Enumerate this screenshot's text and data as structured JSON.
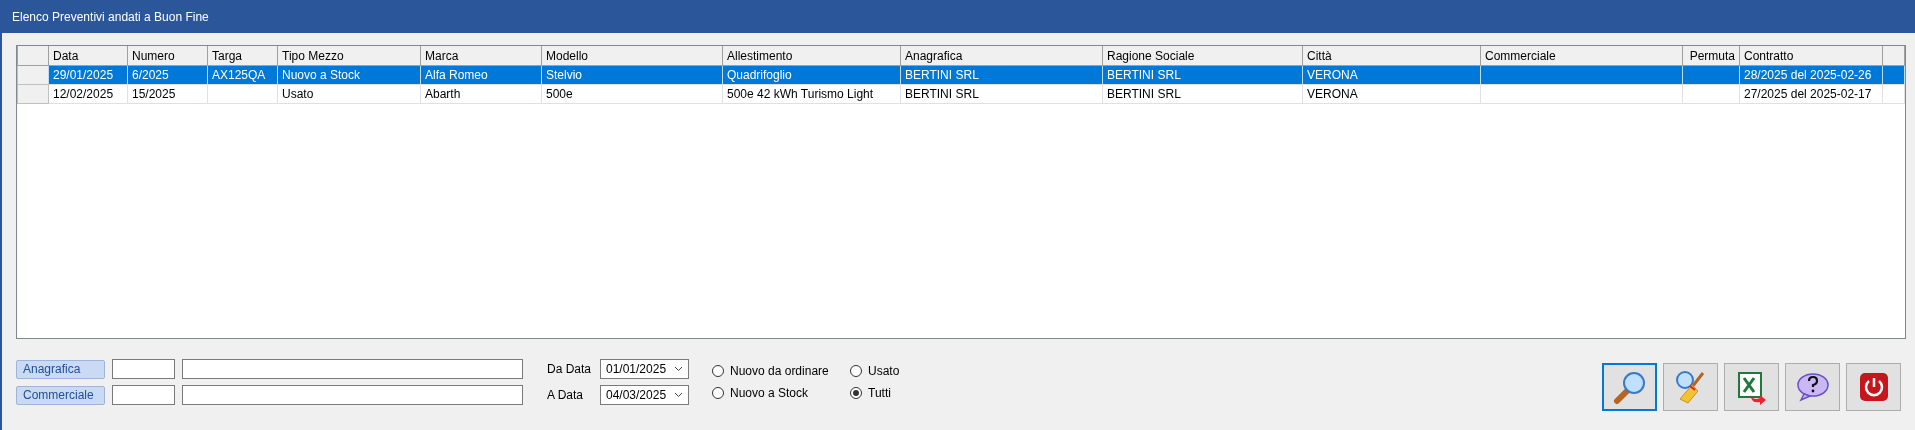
{
  "window": {
    "title": "Elenco Preventivi andati a Buon Fine"
  },
  "table": {
    "columns": [
      "Data",
      "Numero",
      "Targa",
      "Tipo Mezzo",
      "Marca",
      "Modello",
      "Allestimento",
      "Anagrafica",
      "Ragione Sociale",
      "Città",
      "Commerciale",
      "Permuta",
      "Contratto"
    ],
    "rows": [
      {
        "selected": true,
        "cells": [
          "29/01/2025",
          "6/2025",
          "AX125QA",
          "Nuovo a Stock",
          "Alfa Romeo",
          "Stelvio",
          "Quadrifoglio",
          "BERTINI SRL",
          "BERTINI SRL",
          "VERONA",
          "",
          "",
          "28/2025 del 2025-02-26"
        ]
      },
      {
        "selected": false,
        "cells": [
          "12/02/2025",
          "15/2025",
          "",
          "Usato",
          "Abarth",
          "500e",
          "500e 42 kWh Turismo Light",
          "BERTINI SRL",
          "BERTINI SRL",
          "VERONA",
          "",
          "",
          "27/2025 del 2025-02-17"
        ]
      }
    ]
  },
  "filters": [
    {
      "label": "Anagrafica"
    },
    {
      "label": "Commerciale"
    }
  ],
  "dates": [
    {
      "label": "Da Data",
      "value": "01/01/2025"
    },
    {
      "label": "A Data",
      "value": "04/03/2025"
    }
  ],
  "vehicle_types": [
    {
      "label": "Nuovo da ordinare",
      "selected": false
    },
    {
      "label": "Usato",
      "selected": false
    },
    {
      "label": "Nuovo a Stock",
      "selected": false
    },
    {
      "label": "Tutti",
      "selected": true
    }
  ],
  "buttons": [
    {
      "kind": "search",
      "focused": true
    },
    {
      "kind": "clear",
      "focused": false
    },
    {
      "kind": "excel",
      "focused": false
    },
    {
      "kind": "help",
      "focused": false
    },
    {
      "kind": "exit",
      "focused": false
    }
  ]
}
